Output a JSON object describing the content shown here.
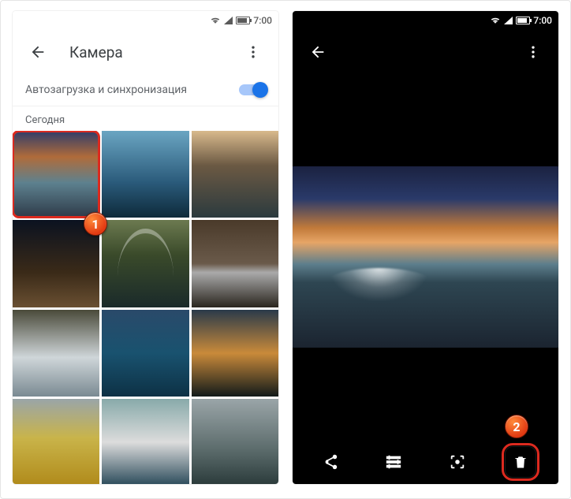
{
  "statusbar": {
    "time": "7:00"
  },
  "left": {
    "title": "Камера",
    "sync_label": "Автозагрузка и синхронизация",
    "section_label": "Сегодня",
    "thumbs": [
      "sunset-falls",
      "blue-wave",
      "peak-lake",
      "night-castle",
      "rainbow-field",
      "canyon-fall",
      "cascade",
      "sea-cloud",
      "sun-sky",
      "sunflower",
      "ice-peak",
      "river-fall"
    ]
  },
  "callouts": {
    "one": "1",
    "two": "2"
  }
}
